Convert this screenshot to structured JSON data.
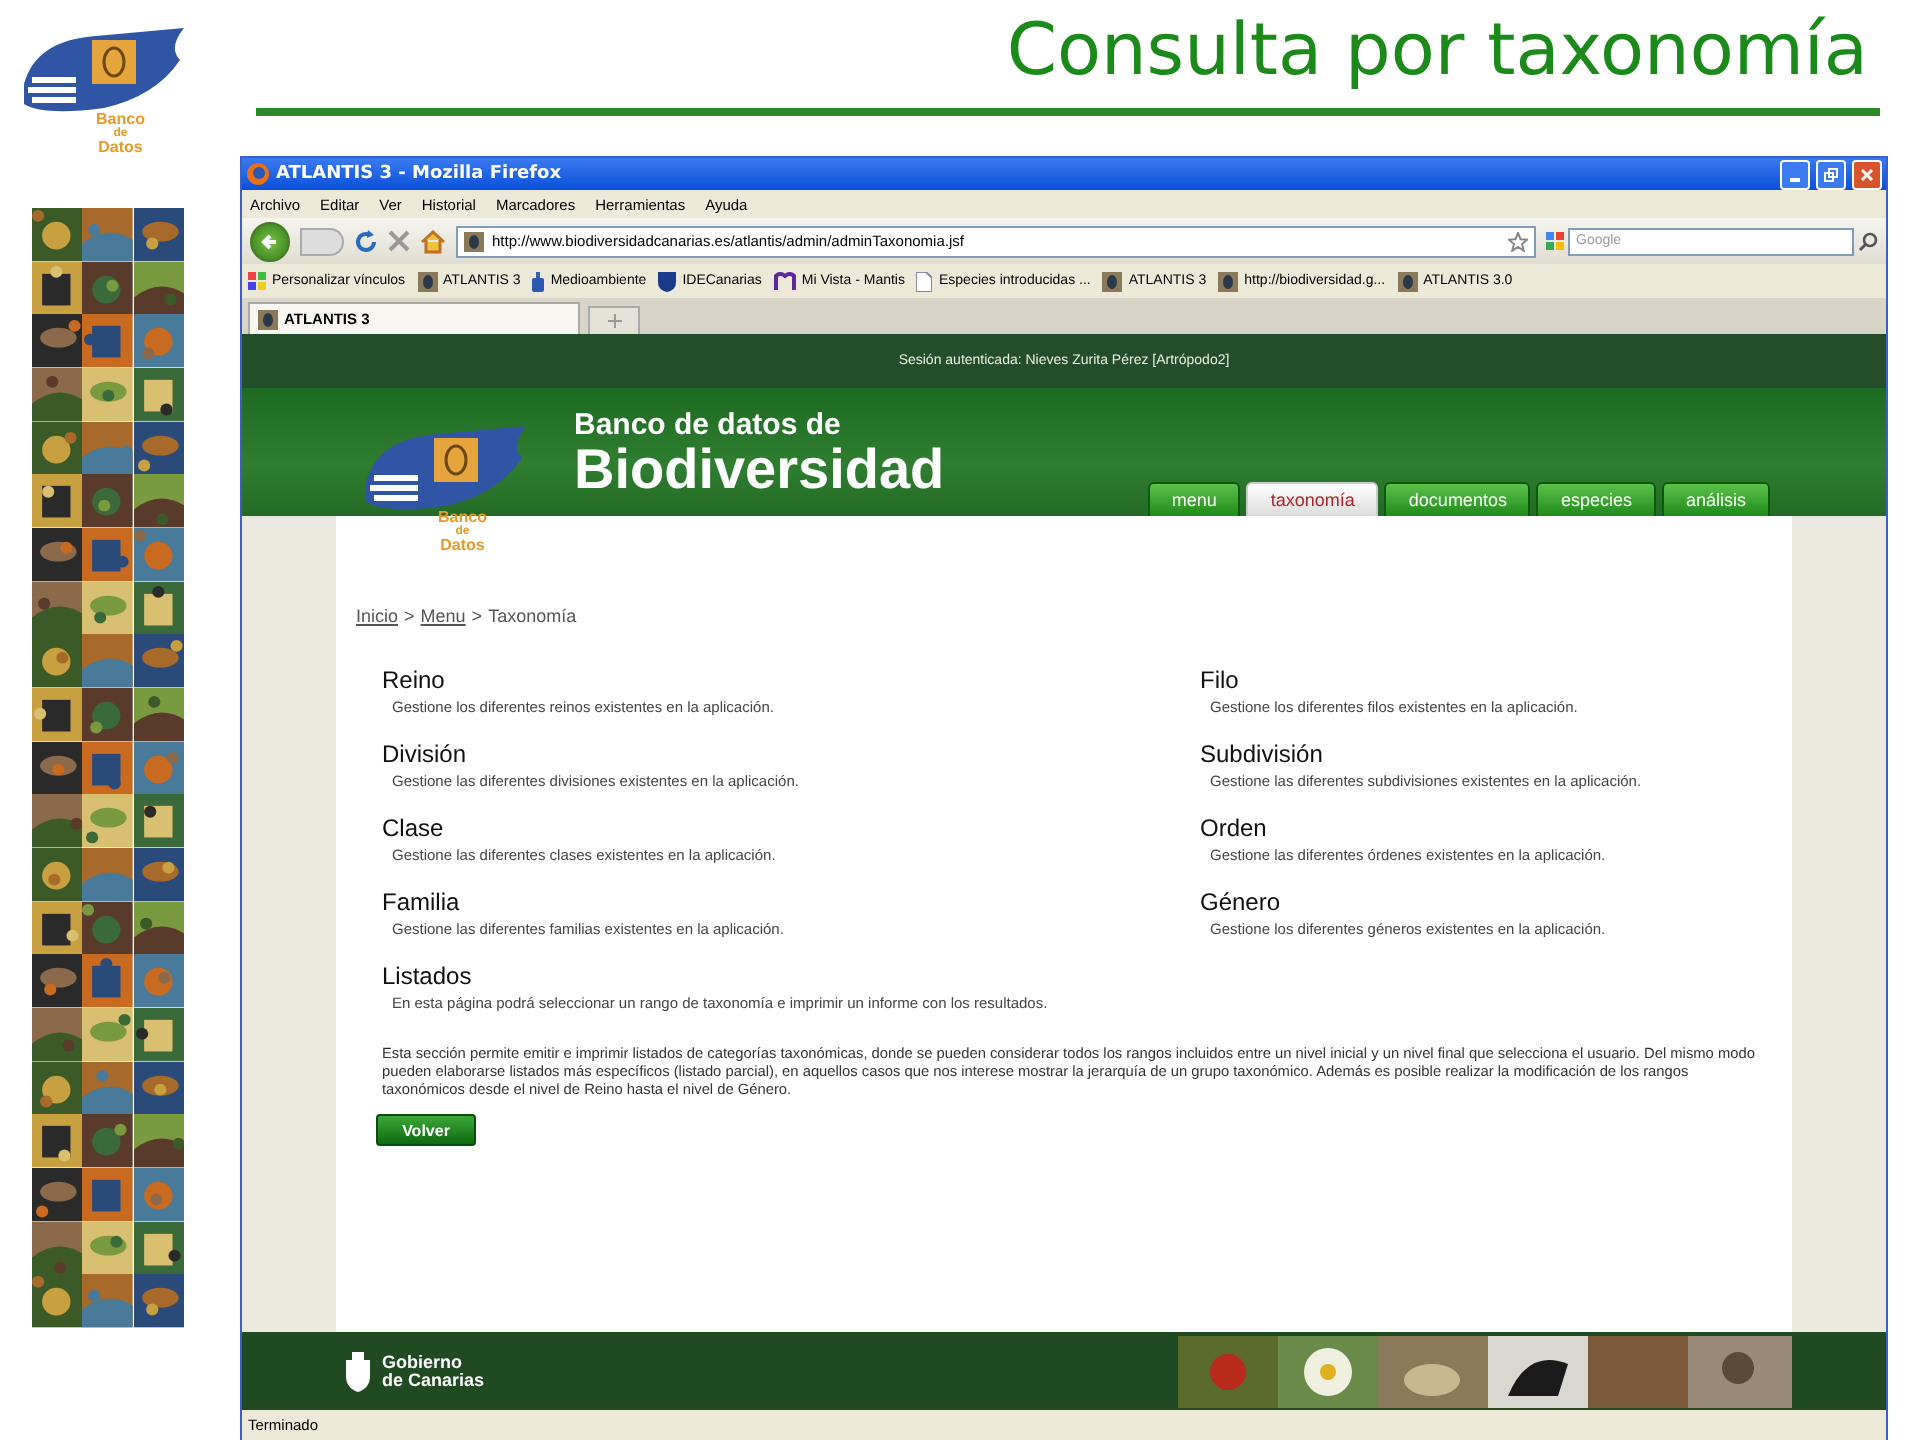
{
  "slide": {
    "title": "Consulta por taxonomía",
    "logo_lines": [
      "Banco",
      "de",
      "Datos"
    ]
  },
  "browser": {
    "window_title": "ATLANTIS 3 - Mozilla Firefox",
    "menu": [
      "Archivo",
      "Editar",
      "Ver",
      "Historial",
      "Marcadores",
      "Herramientas",
      "Ayuda"
    ],
    "url": "http://www.biodiversidadcanarias.es/atlantis/admin/adminTaxonomia.jsf",
    "search_placeholder": "Google",
    "bookmarks": [
      {
        "label": "Personalizar vínculos",
        "kind": "windows"
      },
      {
        "label": "ATLANTIS 3",
        "kind": "atlantis"
      },
      {
        "label": "Medioambiente",
        "kind": "bottle"
      },
      {
        "label": "IDECanarias",
        "kind": "shield"
      },
      {
        "label": "Mi Vista - Mantis",
        "kind": "mantis"
      },
      {
        "label": "Especies introducidas ...",
        "kind": "page"
      },
      {
        "label": "ATLANTIS 3",
        "kind": "atlantis"
      },
      {
        "label": "http://biodiversidad.g...",
        "kind": "atlantis"
      },
      {
        "label": "ATLANTIS 3.0",
        "kind": "atlantis"
      }
    ],
    "tabs": [
      {
        "label": "ATLANTIS 3",
        "selected": true
      }
    ],
    "status": "Terminado"
  },
  "site": {
    "session": "Sesión autenticada: Nieves Zurita Pérez [Artrópodo2]",
    "banner_line1": "Banco de datos de",
    "banner_line2": "Biodiversidad",
    "logo_lines": [
      "Banco",
      "de",
      "Datos"
    ],
    "nav": [
      {
        "label": "menu",
        "selected": false
      },
      {
        "label": "taxonomía",
        "selected": true
      },
      {
        "label": "documentos",
        "selected": false
      },
      {
        "label": "especies",
        "selected": false
      },
      {
        "label": "análisis",
        "selected": false
      }
    ],
    "breadcrumb": {
      "links": [
        "Inicio",
        "Menu"
      ],
      "current": "Taxonomía",
      "separator": ">"
    },
    "columns": [
      [
        {
          "title": "Reino",
          "description": "Gestione los diferentes reinos existentes en la aplicación."
        },
        {
          "title": "División",
          "description": "Gestione las diferentes divisiones existentes en la aplicación."
        },
        {
          "title": "Clase",
          "description": "Gestione las diferentes clases existentes en la aplicación."
        },
        {
          "title": "Familia",
          "description": "Gestione las diferentes familias existentes en la aplicación."
        },
        {
          "title": "Listados",
          "description": "En esta página podrá seleccionar un rango de taxonomía e imprimir un informe con los resultados."
        }
      ],
      [
        {
          "title": "Filo",
          "description": "Gestione los diferentes filos existentes en la aplicación."
        },
        {
          "title": "Subdivisión",
          "description": "Gestione las diferentes subdivisiones existentes en la aplicación."
        },
        {
          "title": "Orden",
          "description": "Gestione las diferentes órdenes existentes en la aplicación."
        },
        {
          "title": "Género",
          "description": "Gestione los diferentes géneros existentes en la aplicación."
        }
      ]
    ],
    "paragraph": "Esta sección permite emitir e imprimir listados de categorías taxonómicas, donde se pueden considerar todos los rangos incluidos entre un nivel inicial y un nivel final que selecciona el usuario. Del mismo modo pueden elaborarse listados más específicos (listado parcial), en aquellos casos que nos interese mostrar la jerarquía de un grupo taxonómico. Además es posible realizar la modificación de los rangos taxonómicos desde el nivel de Reino hasta el nivel de Género.",
    "button": "Volver",
    "footer_logo": [
      "Gobierno",
      "de Canarias"
    ]
  }
}
